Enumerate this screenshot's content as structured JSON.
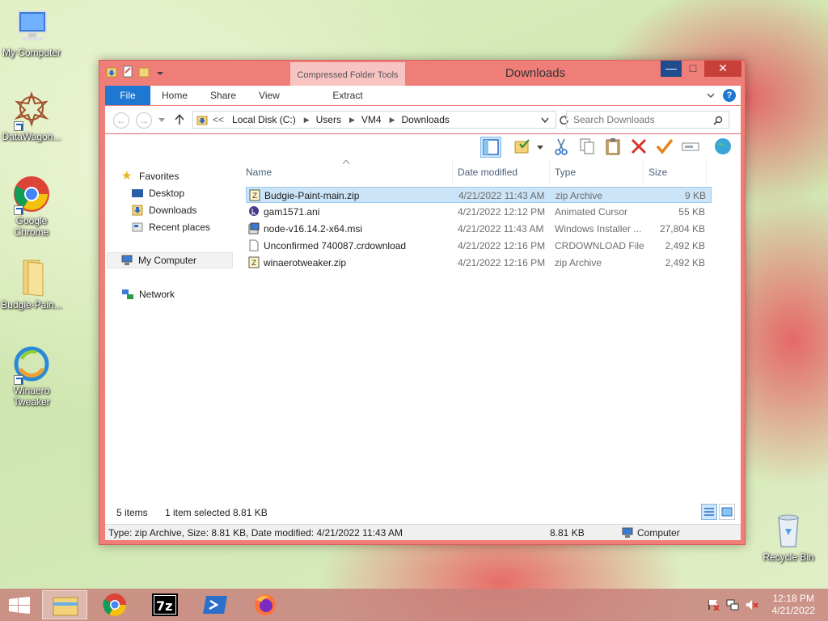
{
  "desktop": {
    "icons": [
      {
        "label": "My Computer"
      },
      {
        "label": "DataWagon..."
      },
      {
        "label": "Google Chrome"
      },
      {
        "label": "Budgie-Pain..."
      },
      {
        "label": "Winaero Tweaker"
      },
      {
        "label": "Recycle Bin"
      }
    ]
  },
  "window": {
    "title": "Downloads",
    "context_tab_group": "Compressed Folder Tools",
    "ribbon_tabs": {
      "file": "File",
      "home": "Home",
      "share": "Share",
      "view": "View",
      "extract": "Extract"
    },
    "address": {
      "prefix": "<<",
      "segments": [
        "Local Disk (C:)",
        "Users",
        "VM4",
        "Downloads"
      ]
    },
    "search": {
      "placeholder": "Search Downloads"
    },
    "nav": {
      "favorites": "Favorites",
      "desktop": "Desktop",
      "downloads": "Downloads",
      "recent": "Recent places",
      "computer": "My Computer",
      "network": "Network"
    },
    "columns": {
      "name": "Name",
      "date": "Date modified",
      "type": "Type",
      "size": "Size"
    },
    "files": [
      {
        "name": "Budgie-Paint-main.zip",
        "date": "4/21/2022 11:43 AM",
        "type": "zip Archive",
        "size": "9 KB"
      },
      {
        "name": "gam1571.ani",
        "date": "4/21/2022 12:12 PM",
        "type": "Animated Cursor",
        "size": "55 KB"
      },
      {
        "name": "node-v16.14.2-x64.msi",
        "date": "4/21/2022 11:43 AM",
        "type": "Windows Installer ...",
        "size": "27,804 KB"
      },
      {
        "name": "Unconfirmed 740087.crdownload",
        "date": "4/21/2022 12:16 PM",
        "type": "CRDOWNLOAD File",
        "size": "2,492 KB"
      },
      {
        "name": "winaerotweaker.zip",
        "date": "4/21/2022 12:16 PM",
        "type": "zip Archive",
        "size": "2,492 KB"
      }
    ],
    "status": {
      "items": "5 items",
      "selected": "1 item selected  8.81 KB"
    },
    "details": {
      "info": "Type: zip Archive, Size: 8.81 KB, Date modified: 4/21/2022 11:43 AM",
      "size": "8.81 KB",
      "location": "Computer"
    }
  },
  "taskbar": {
    "time": "12:18 PM",
    "date": "4/21/2022"
  },
  "colors": {
    "accent": "#1e78d2",
    "window_frame": "#f07e78",
    "selection": "#cce4f7"
  }
}
